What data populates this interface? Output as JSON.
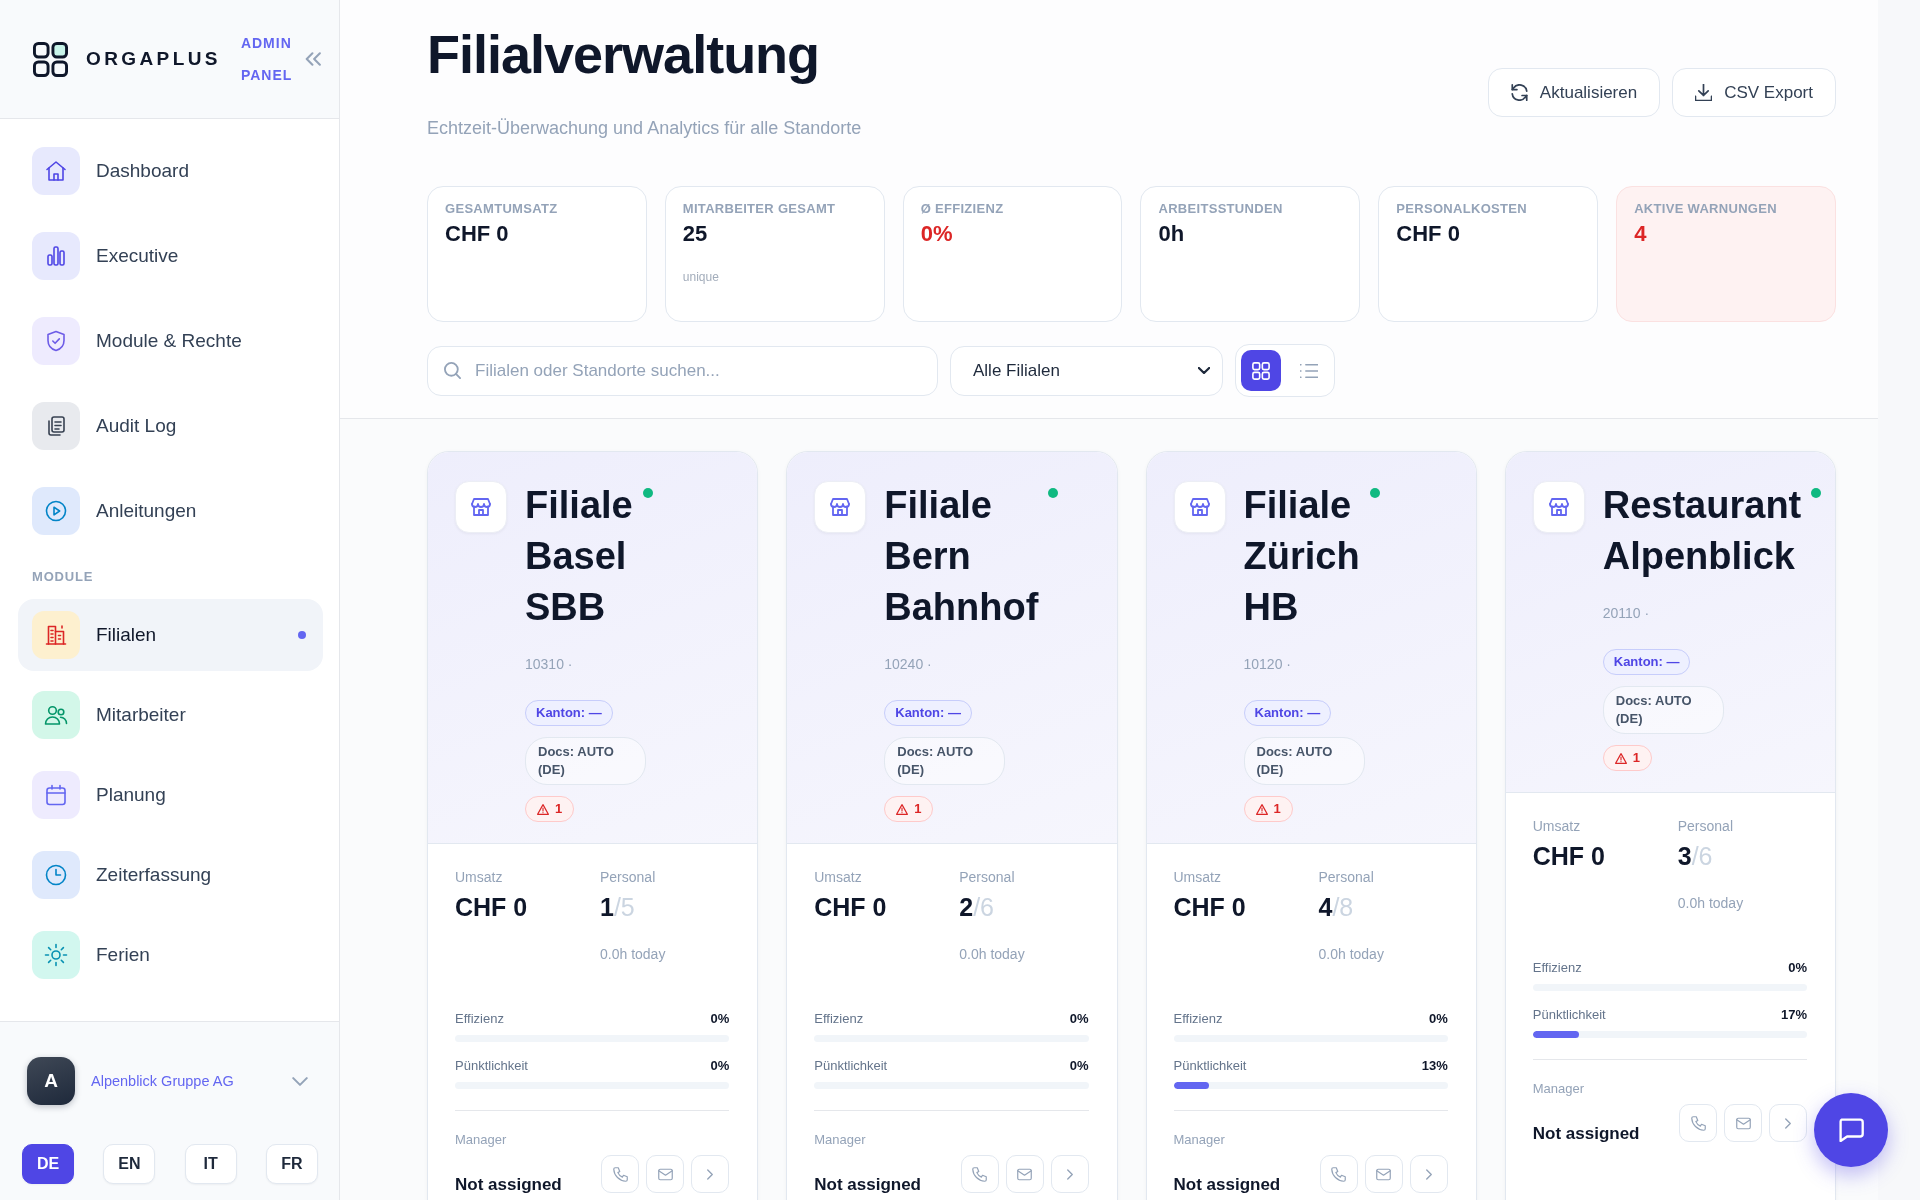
{
  "sidebar": {
    "brand": "ORGAPLUS",
    "panel_label": "ADMIN PANEL",
    "nav_groups": [
      {
        "items": [
          {
            "label": "Dashboard",
            "selected": false
          },
          {
            "label": "Executive",
            "selected": false
          },
          {
            "label": "Module & Rechte",
            "selected": false
          },
          {
            "label": "Audit Log",
            "selected": false
          },
          {
            "label": "Anleitungen",
            "selected": false
          }
        ]
      },
      {
        "title": "MODULE",
        "items": [
          {
            "label": "Filialen",
            "selected": true
          },
          {
            "label": "Mitarbeiter",
            "selected": false
          },
          {
            "label": "Planung",
            "selected": false
          },
          {
            "label": "Zeiterfassung",
            "selected": false
          },
          {
            "label": "Ferien",
            "selected": false
          }
        ]
      }
    ],
    "organization": {
      "avatar": "A",
      "name": "Alpenblick Gruppe AG"
    },
    "languages": [
      {
        "label": "DE",
        "selected": true
      },
      {
        "label": "EN",
        "selected": false
      },
      {
        "label": "IT",
        "selected": false
      },
      {
        "label": "FR",
        "selected": false
      }
    ]
  },
  "header": {
    "title": "Filialverwaltung",
    "subtitle": "Echtzeit-Überwachung und Analytics für alle Standorte",
    "buttons": [
      {
        "kind": "refresh",
        "label": "Aktualisieren"
      },
      {
        "kind": "export",
        "label": "CSV Export"
      }
    ]
  },
  "stats": [
    {
      "label": "GESAMTUMSATZ",
      "value": "CHF 0",
      "kind": "plain"
    },
    {
      "label": "MITARBEITER GESAMT",
      "value": "25",
      "note": "unique",
      "kind": "plain"
    },
    {
      "label": "Ø EFFIZIENZ",
      "value": "0%",
      "kind": "negative"
    },
    {
      "label": "ARBEITSSTUNDEN",
      "value": "0h",
      "kind": "plain"
    },
    {
      "label": "PERSONALKOSTEN",
      "value": "CHF 0",
      "kind": "plain"
    },
    {
      "label": "AKTIVE WARNUNGEN",
      "value": "4",
      "kind": "alert"
    }
  ],
  "filters": {
    "search": {
      "placeholder": "Filialen oder Standorte suchen..."
    },
    "branch_select": {
      "value": "Alle Filialen"
    },
    "view_modes": [
      {
        "kind": "grid",
        "selected": true
      },
      {
        "kind": "list",
        "selected": false
      }
    ]
  },
  "branches": [
    {
      "name": "Filiale Basel SBB",
      "active": true,
      "code": "10310 ·",
      "tags": [
        {
          "kind": "canton",
          "text": "Kanton: —"
        },
        {
          "kind": "docs",
          "text": "Docs: AUTO (DE)"
        },
        {
          "kind": "warning",
          "text": "1"
        }
      ],
      "revenue_label": "Umsatz",
      "revenue": "CHF 0",
      "staff_label": "Personal",
      "staff": "1",
      "staff_total": "/5",
      "hours": "0.0h today",
      "bars": [
        {
          "label": "Effizienz",
          "reading": "0%",
          "level": 0
        },
        {
          "label": "Pünktlichkeit",
          "reading": "0%",
          "level": 0
        }
      ],
      "manager_label": "Manager",
      "manager": "Not assigned"
    },
    {
      "name": "Filiale Bern Bahnhof",
      "active": true,
      "code": "10240 ·",
      "tags": [
        {
          "kind": "canton",
          "text": "Kanton: —"
        },
        {
          "kind": "docs",
          "text": "Docs: AUTO (DE)"
        },
        {
          "kind": "warning",
          "text": "1"
        }
      ],
      "revenue_label": "Umsatz",
      "revenue": "CHF 0",
      "staff_label": "Personal",
      "staff": "2",
      "staff_total": "/6",
      "hours": "0.0h today",
      "bars": [
        {
          "label": "Effizienz",
          "reading": "0%",
          "level": 0
        },
        {
          "label": "Pünktlichkeit",
          "reading": "0%",
          "level": 0
        }
      ],
      "manager_label": "Manager",
      "manager": "Not assigned"
    },
    {
      "name": "Filiale Zürich HB",
      "active": true,
      "code": "10120 ·",
      "tags": [
        {
          "kind": "canton",
          "text": "Kanton: —"
        },
        {
          "kind": "docs",
          "text": "Docs: AUTO (DE)"
        },
        {
          "kind": "warning",
          "text": "1"
        }
      ],
      "revenue_label": "Umsatz",
      "revenue": "CHF 0",
      "staff_label": "Personal",
      "staff": "4",
      "staff_total": "/8",
      "hours": "0.0h today",
      "bars": [
        {
          "label": "Effizienz",
          "reading": "0%",
          "level": 0
        },
        {
          "label": "Pünktlichkeit",
          "reading": "13%",
          "level": 0.13
        }
      ],
      "manager_label": "Manager",
      "manager": "Not assigned"
    },
    {
      "name": "Restaurant Alpenblick",
      "active": true,
      "code": "20110 ·",
      "tags": [
        {
          "kind": "canton",
          "text": "Kanton: —"
        },
        {
          "kind": "docs",
          "text": "Docs: AUTO (DE)"
        },
        {
          "kind": "warning",
          "text": "1"
        }
      ],
      "revenue_label": "Umsatz",
      "revenue": "CHF 0",
      "staff_label": "Personal",
      "staff": "3",
      "staff_total": "/6",
      "hours": "0.0h today",
      "bars": [
        {
          "label": "Effizienz",
          "reading": "0%",
          "level": 0
        },
        {
          "label": "Pünktlichkeit",
          "reading": "17%",
          "level": 0.17
        }
      ],
      "manager_label": "Manager",
      "manager": "Not assigned"
    }
  ]
}
